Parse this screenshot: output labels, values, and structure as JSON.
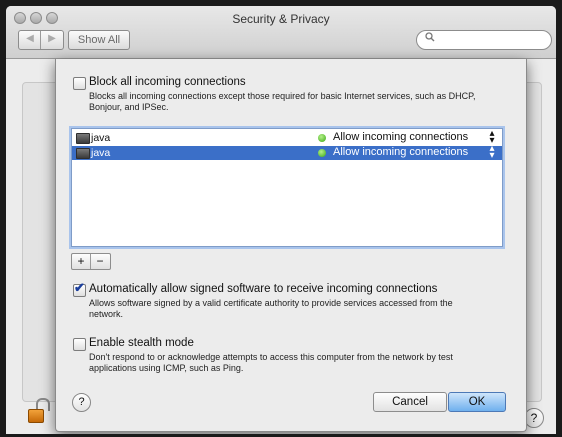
{
  "window": {
    "title": "Security & Privacy"
  },
  "toolbar": {
    "back_glyph": "◀",
    "forward_glyph": "▶",
    "show_all_label": "Show All",
    "search_placeholder": "",
    "search_icon": "magnifier-icon"
  },
  "firewall_sheet": {
    "block_all": {
      "checked": false,
      "label": "Block all incoming connections",
      "description": "Blocks all incoming connections except those required for basic Internet services, such as DHCP, Bonjour, and IPSec."
    },
    "app_list": [
      {
        "name": "java",
        "status": "Allow incoming connections",
        "selected": false
      },
      {
        "name": "java",
        "status": "Allow incoming connections",
        "selected": true
      }
    ],
    "list_buttons": {
      "add_label": "+",
      "remove_label": "−"
    },
    "auto_allow": {
      "checked": true,
      "label": "Automatically allow signed software to receive incoming connections",
      "description": "Allows software signed by a valid certificate authority to provide services accessed from the network."
    },
    "stealth": {
      "checked": false,
      "label": "Enable stealth mode",
      "description": "Don't respond to or acknowledge attempts to access this computer from the network by test applications using ICMP, such as Ping."
    },
    "help_label": "?",
    "cancel_label": "Cancel",
    "ok_label": "OK"
  },
  "background": {
    "help_label": "?",
    "lock_icon": "lock-open-icon"
  },
  "colors": {
    "selection": "#3b6fc8",
    "status_green": "#3aa814",
    "ok_button": "#6fb0ee"
  }
}
